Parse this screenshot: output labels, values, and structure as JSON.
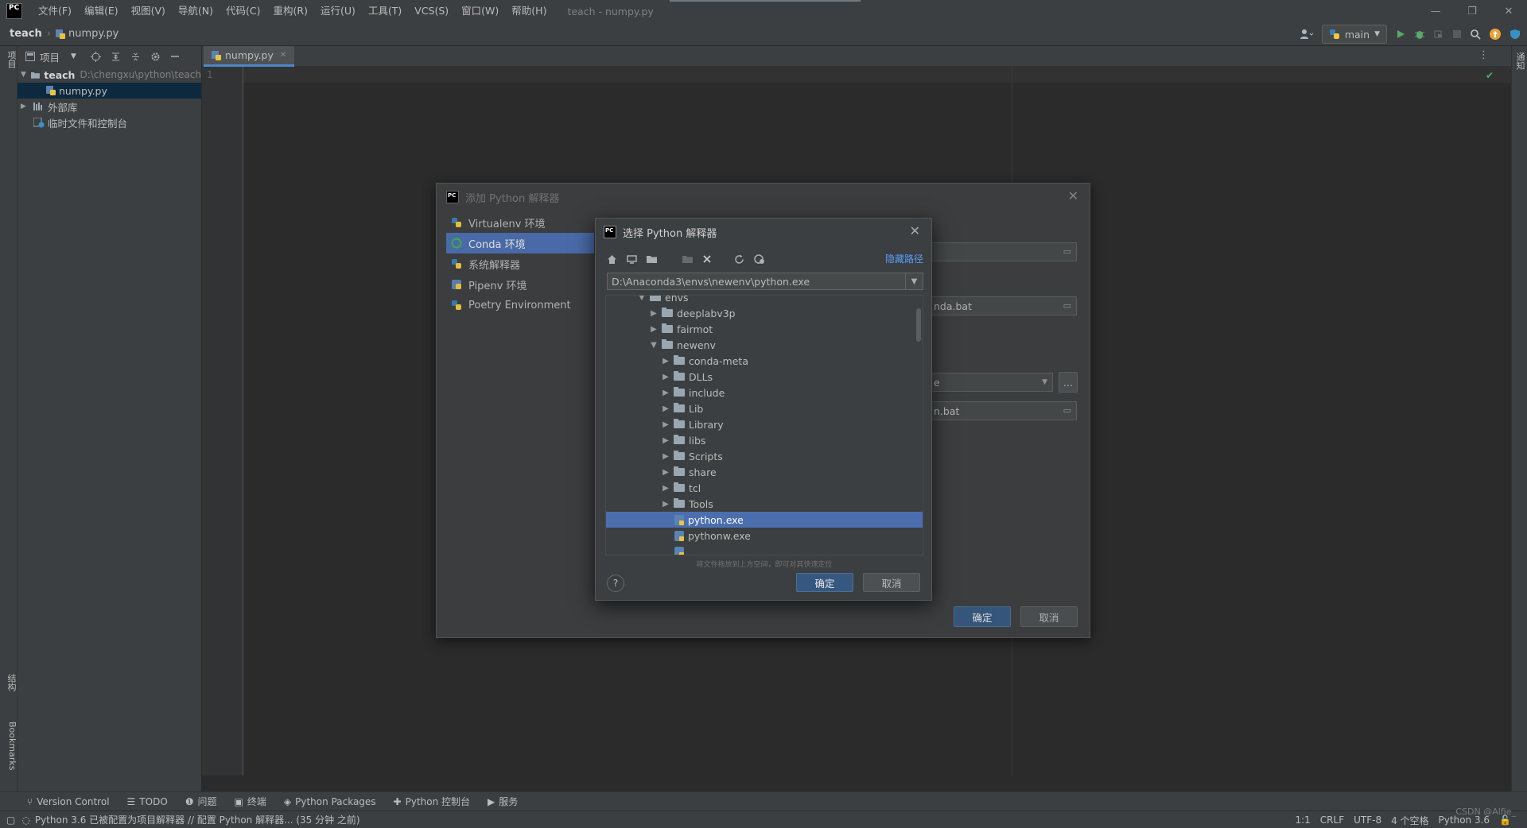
{
  "titlebar": {
    "logo": "PC",
    "menu": [
      "文件(F)",
      "编辑(E)",
      "视图(V)",
      "导航(N)",
      "代码(C)",
      "重构(R)",
      "运行(U)",
      "工具(T)",
      "VCS(S)",
      "窗口(W)",
      "帮助(H)"
    ],
    "window_title": "teach - numpy.py",
    "controls": {
      "minimize": "—",
      "restore": "❐",
      "close": "✕"
    }
  },
  "navbar": {
    "project": "teach",
    "file": "numpy.py",
    "run_config": "main"
  },
  "left_stripe": {
    "project_label": "项目",
    "structure_label": "结构",
    "bookmarks_label": "Bookmarks"
  },
  "right_stripe": {
    "notifications_label": "通知"
  },
  "project_panel": {
    "header_label": "项目",
    "tree": [
      {
        "label": "teach",
        "path": "D:\\chengxu\\python\\teach"
      },
      {
        "label": "numpy.py"
      },
      {
        "label": "外部库"
      },
      {
        "label": "临时文件和控制台"
      }
    ]
  },
  "editor": {
    "tab_label": "numpy.py",
    "line_number": "1"
  },
  "outer_dialog": {
    "title": "添加 Python 解释器",
    "env_types": [
      "Virtualenv 环境",
      "Conda 环境",
      "系统解释器",
      "Pipenv 环境",
      "Poetry Environment"
    ],
    "selected_env": "Conda 环境",
    "field_conda_exe": "nda.bat",
    "field_dropdown": "e",
    "field_activate": "n.bat",
    "ellipsis": "...",
    "ok_label": "确定",
    "cancel_label": "取消"
  },
  "inner_dialog": {
    "title": "选择 Python 解释器",
    "hide_path_label": "隐藏路径",
    "path_value": "D:\\Anaconda3\\envs\\newenv\\python.exe",
    "tree": [
      {
        "label": "envs",
        "depth": 2,
        "kind": "folder",
        "expanded": true
      },
      {
        "label": "deeplabv3p",
        "depth": 3,
        "kind": "folder",
        "expanded": false
      },
      {
        "label": "fairmot",
        "depth": 3,
        "kind": "folder",
        "expanded": false
      },
      {
        "label": "newenv",
        "depth": 3,
        "kind": "folder",
        "expanded": true
      },
      {
        "label": "conda-meta",
        "depth": 4,
        "kind": "folder",
        "expanded": false
      },
      {
        "label": "DLLs",
        "depth": 4,
        "kind": "folder",
        "expanded": false
      },
      {
        "label": "include",
        "depth": 4,
        "kind": "folder",
        "expanded": false
      },
      {
        "label": "Lib",
        "depth": 4,
        "kind": "folder",
        "expanded": false
      },
      {
        "label": "Library",
        "depth": 4,
        "kind": "folder",
        "expanded": false
      },
      {
        "label": "libs",
        "depth": 4,
        "kind": "folder",
        "expanded": false
      },
      {
        "label": "Scripts",
        "depth": 4,
        "kind": "folder",
        "expanded": false
      },
      {
        "label": "share",
        "depth": 4,
        "kind": "folder",
        "expanded": false
      },
      {
        "label": "tcl",
        "depth": 4,
        "kind": "folder",
        "expanded": false
      },
      {
        "label": "Tools",
        "depth": 4,
        "kind": "folder",
        "expanded": false
      },
      {
        "label": "python.exe",
        "depth": 4,
        "kind": "file",
        "selected": true
      },
      {
        "label": "pythonw.exe",
        "depth": 4,
        "kind": "file"
      },
      {
        "label": "",
        "depth": 4,
        "kind": "file"
      }
    ],
    "hint": "将文件拖放到上方空间，即可对其快速定位",
    "help_label": "?",
    "ok_label": "确定",
    "cancel_label": "取消"
  },
  "tool_tabs": [
    "Version Control",
    "TODO",
    "问题",
    "终端",
    "Python Packages",
    "Python 控制台",
    "服务"
  ],
  "statusbar": {
    "message": "Python 3.6 已被配置为项目解释器 // 配置 Python 解释器... (35 分钟 之前)",
    "position": "1:1",
    "line_sep": "CRLF",
    "encoding": "UTF-8",
    "indent": "4 个空格",
    "interpreter": "Python 3.6",
    "watermark": "CSDN @Alfie_"
  },
  "colors": {
    "accent": "#4b6eaf",
    "primary_button": "#365880",
    "background": "#2b2b2b",
    "panel": "#3c3f41"
  }
}
